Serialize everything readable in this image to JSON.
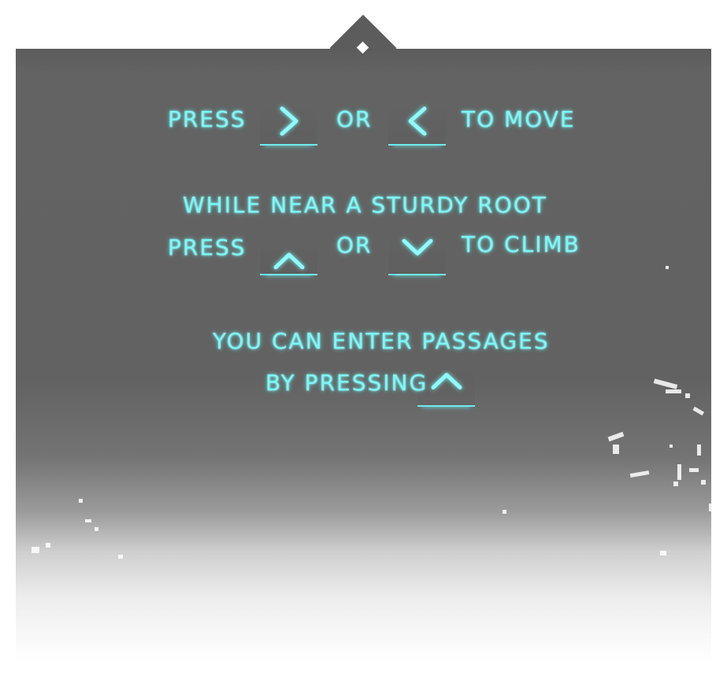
{
  "tutorial": {
    "move": {
      "press": "PRESS",
      "or": "OR",
      "action": "TO MOVE"
    },
    "climb": {
      "condition": "WHILE NEAR A STURDY ROOT",
      "press": "PRESS",
      "or": "OR",
      "action": "TO CLIMB"
    },
    "passage": {
      "line1": "YOU CAN ENTER PASSAGES",
      "line2": "BY PRESSING"
    }
  },
  "keys": {
    "right": "right-arrow-icon",
    "left": "left-arrow-icon",
    "up": "up-arrow-icon",
    "down": "down-arrow-icon"
  },
  "colors": {
    "text": "#7ff6f6",
    "panel": "#5c5c5c",
    "fog": "#ffffff"
  }
}
